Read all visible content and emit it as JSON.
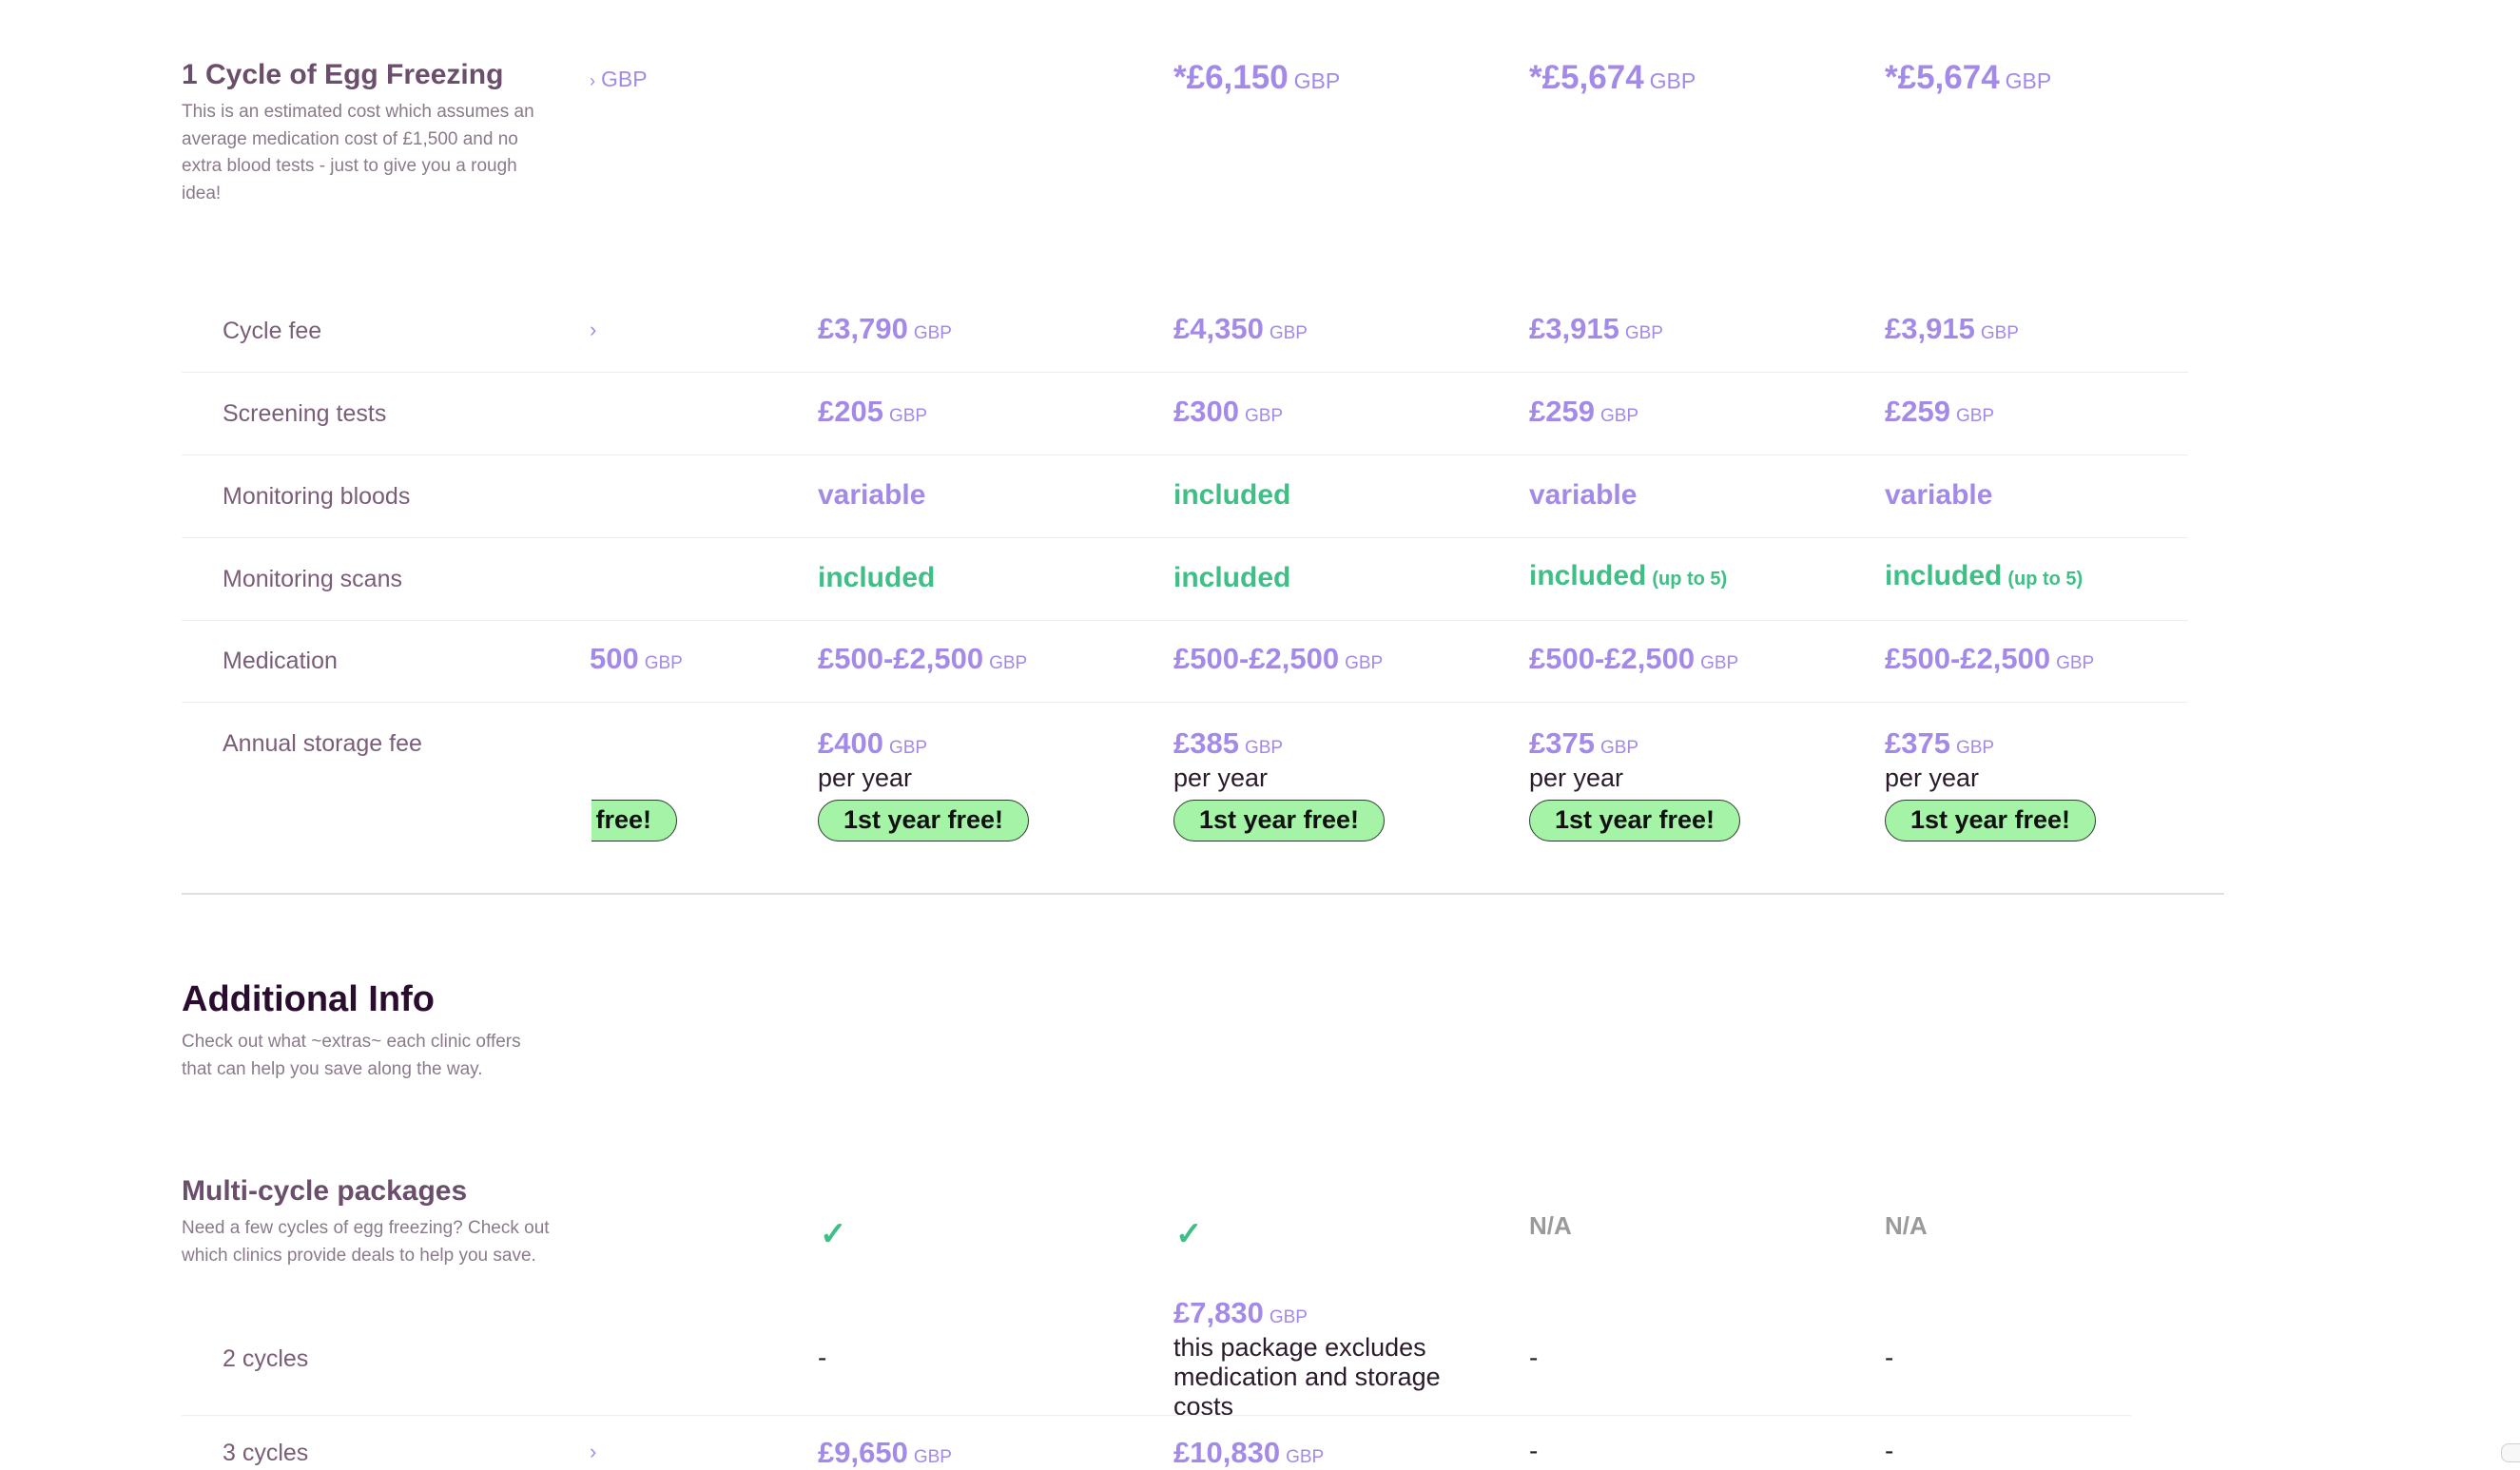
{
  "egg_freezing": {
    "title": "1 Cycle of Egg Freezing",
    "description": "This is an estimated cost which assumes an average medication cost of £1,500 and no extra blood tests - just to give you a rough idea!",
    "partial_currency": "GBP",
    "totals": [
      {
        "amount": "*£6,150",
        "currency": "GBP"
      },
      {
        "amount": "*£5,674",
        "currency": "GBP"
      },
      {
        "amount": "*£5,674",
        "currency": "GBP"
      }
    ]
  },
  "rows": {
    "cycle_fee": {
      "label": "Cycle fee",
      "partial": "›",
      "values": [
        {
          "amount": "£3,790",
          "currency": "GBP"
        },
        {
          "amount": "£4,350",
          "currency": "GBP"
        },
        {
          "amount": "£3,915",
          "currency": "GBP"
        },
        {
          "amount": "£3,915",
          "currency": "GBP"
        }
      ]
    },
    "screening": {
      "label": "Screening tests",
      "values": [
        {
          "amount": "£205",
          "currency": "GBP"
        },
        {
          "amount": "£300",
          "currency": "GBP"
        },
        {
          "amount": "£259",
          "currency": "GBP"
        },
        {
          "amount": "£259",
          "currency": "GBP"
        }
      ]
    },
    "monitoring_bloods": {
      "label": "Monitoring bloods",
      "values": [
        "variable",
        "included",
        "variable",
        "variable"
      ]
    },
    "monitoring_scans": {
      "label": "Monitoring scans",
      "values": [
        "included",
        "included",
        "included",
        "included"
      ],
      "notes": [
        "",
        "",
        "(up to 5)",
        "(up to 5)"
      ]
    },
    "medication": {
      "label": "Medication",
      "partial_amount": "500",
      "partial_currency": "GBP",
      "values": [
        {
          "amount": "£500-£2,500",
          "currency": "GBP"
        },
        {
          "amount": "£500-£2,500",
          "currency": "GBP"
        },
        {
          "amount": "£500-£2,500",
          "currency": "GBP"
        },
        {
          "amount": "£500-£2,500",
          "currency": "GBP"
        }
      ]
    },
    "storage": {
      "label": "Annual storage fee",
      "per_year": "per year",
      "badge": "1st year free!",
      "values": [
        {
          "amount": "£400",
          "currency": "GBP"
        },
        {
          "amount": "£385",
          "currency": "GBP"
        },
        {
          "amount": "£375",
          "currency": "GBP"
        },
        {
          "amount": "£375",
          "currency": "GBP"
        }
      ]
    }
  },
  "additional": {
    "title": "Additional Info",
    "description": "Check out what ~extras~ each clinic offers that can help you save along the way."
  },
  "multi_cycle": {
    "title": "Multi-cycle packages",
    "description": "Need a few cycles of egg freezing? Check out which clinics provide deals to help you save.",
    "availability": [
      "✓",
      "✓",
      "N/A",
      "N/A"
    ],
    "two_cycles": {
      "label": "2 cycles",
      "c1": "-",
      "c2_amount": "£7,830",
      "c2_currency": "GBP",
      "c2_note": "this package excludes medication and storage costs",
      "c3": "-",
      "c4": "-"
    },
    "three_cycles": {
      "label": "3 cycles",
      "partial": "›",
      "c1_amount": "£9,650",
      "c1_currency": "GBP",
      "c2_amount": "£10,830",
      "c2_currency": "GBP",
      "c3": "-",
      "c4": "-"
    }
  }
}
